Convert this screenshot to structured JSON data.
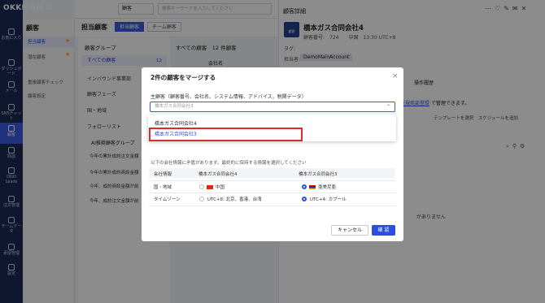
{
  "app": {
    "logo": "OKKICRM",
    "logo_badge": "AI"
  },
  "rail": [
    {
      "label": "お気に入り",
      "active": false
    },
    {
      "label": "ダッシュボード",
      "active": false
    },
    {
      "label": "メール",
      "active": false
    },
    {
      "label": "SNSチャット",
      "active": false
    },
    {
      "label": "顧客",
      "active": true
    },
    {
      "label": "商談",
      "active": false
    },
    {
      "label": "OKKI Leads",
      "active": false
    },
    {
      "label": "注文管理",
      "active": false
    },
    {
      "label": "チームデータ",
      "active": false
    },
    {
      "label": "承認管理",
      "active": false
    },
    {
      "label": "設定",
      "active": false
    }
  ],
  "sidebar2": {
    "title": "顧客",
    "items": [
      "担当顧客",
      "潜在顧客",
      "重複顧客チェック",
      "顧客設定"
    ]
  },
  "topbar": {
    "select": "顧客",
    "search_placeholder": "検索キーワードを入力してください"
  },
  "main": {
    "title": "担当顧客",
    "tabs": [
      "担当顧客",
      "チーム顧客"
    ],
    "group_title": "顧客グループ",
    "groups": [
      "すべての顧客",
      "インバウンド事業部",
      "顧客フェーズ",
      "国・地域",
      "フォローリスト"
    ],
    "group_count": "12",
    "ai_title": "AI推奨顧客グループ",
    "ai_items": [
      "今年の累計成約注文金額",
      "今年の累計成約商談金額",
      "今年、成約商談金額が前",
      "今年、成約注文金額が前"
    ],
    "all_customers": "すべての顧客　12 件顧客",
    "col_header": "会社名"
  },
  "right": {
    "title": "顧客詳細",
    "company": "橋本ガス合同会社4",
    "avatar_label": "顧客",
    "info": "顧客番号:　724　　中国　13:30 UTC+8",
    "tag_label": "タグ:",
    "owner_label": "担当者:",
    "owner": "DemoMainAccount",
    "tab": "操作履歴",
    "link_prefix": "こ",
    "link": "新規商談登録",
    "link_suffix": "で管理できます。",
    "template": "テンプレートを選択",
    "schedule": "スケジュールを追加",
    "nodata": "がありません"
  },
  "modal": {
    "title": "2件の顧客をマージする",
    "label": "主顧客（顧客番号、会社名、システム情報、アドバイス，税関データ）",
    "placeholder": "橋本ガス合同会社3",
    "options": [
      "橋本ガス合同会社4",
      "橋本ガス合同会社3"
    ],
    "note": "以下の会社情報に矛盾があります。最終的に保持する情報を選択してください",
    "headers": [
      "会社情報",
      "橋本ガス合同会社4",
      "橋本ガス合同会社3"
    ],
    "rows": [
      {
        "field": "国・地域",
        "a": "中国",
        "b": "亜美尼亜"
      },
      {
        "field": "タイムゾーン",
        "a": "UTC+8: 北京、香港、台湾",
        "b": "UTC+4: カブール"
      }
    ],
    "cancel": "キャンセル",
    "ok": "確 認"
  },
  "colors": {
    "accent": "#3b59e6",
    "nav": "#1d2a57",
    "highlight": "#e0282e"
  }
}
